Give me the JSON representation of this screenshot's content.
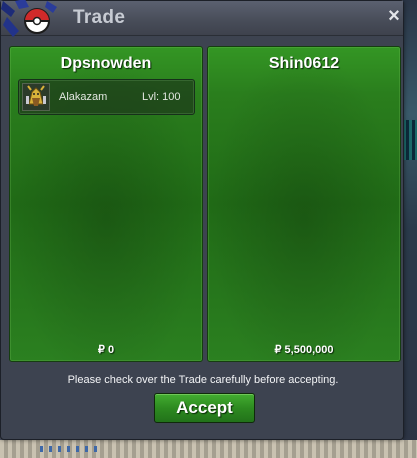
{
  "window": {
    "title": "Trade",
    "close_icon": "close-icon"
  },
  "left_panel": {
    "player": "Dpsnowden",
    "items": [
      {
        "name": "Alakazam",
        "level": "Lvl: 100",
        "icon": "alakazam-sprite-icon"
      }
    ],
    "money": "₽ 0"
  },
  "right_panel": {
    "player": "Shin0612",
    "items": [],
    "money": "₽ 5,500,000"
  },
  "notice": "Please check over the Trade carefully before accepting.",
  "accept_label": "Accept",
  "colors": {
    "panel_green": "#2a7e1d",
    "button_green": "#2d8a20",
    "window_bg": "#3d4350"
  }
}
